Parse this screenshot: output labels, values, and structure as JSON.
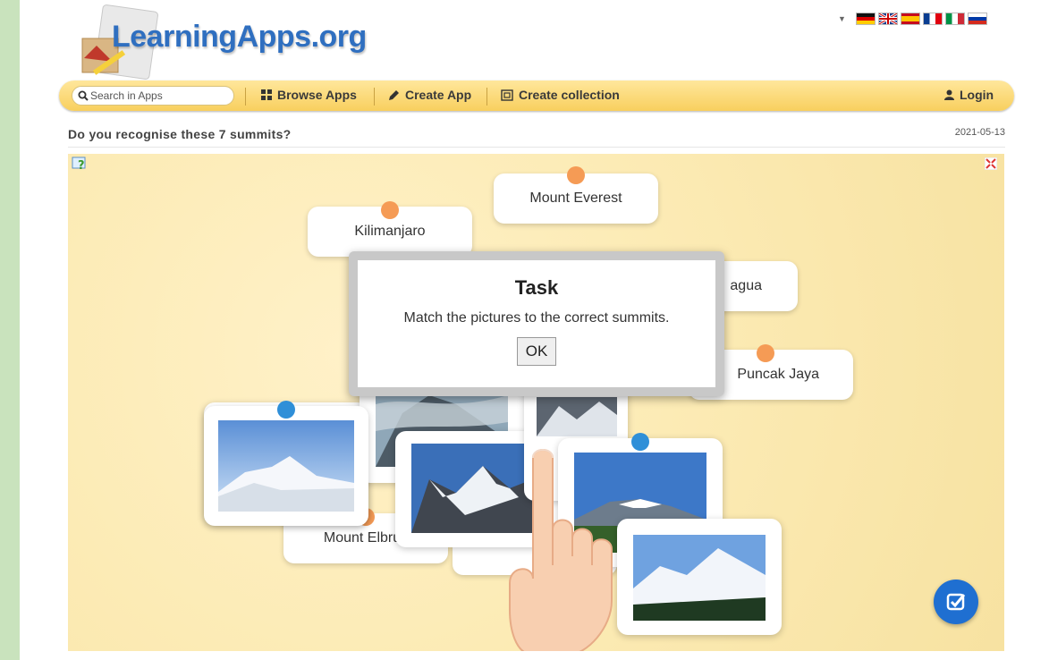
{
  "header": {
    "logo_text": "LearningApps.org",
    "languages": [
      "de",
      "en",
      "es",
      "fr",
      "it",
      "ru"
    ]
  },
  "navbar": {
    "search_placeholder": "Search in Apps",
    "browse_label": "Browse Apps",
    "create_label": "Create App",
    "collection_label": "Create collection",
    "login_label": "Login"
  },
  "page": {
    "title": "Do you recognise these 7 summits?",
    "date": "2021-05-13"
  },
  "app": {
    "labels": {
      "everest": "Mount Everest",
      "kilimanjaro": "Kilimanjaro",
      "aconcagua_partial": "agua",
      "puncak": "Puncak Jaya",
      "elbrus": "Mount Elbrus"
    },
    "modal": {
      "title": "Task",
      "text": "Match the pictures to the correct summits.",
      "ok": "OK"
    },
    "colors": {
      "orange_dot": "#f59b55",
      "blue_dot": "#2f8fd8",
      "check": "#1f6fd1"
    }
  }
}
